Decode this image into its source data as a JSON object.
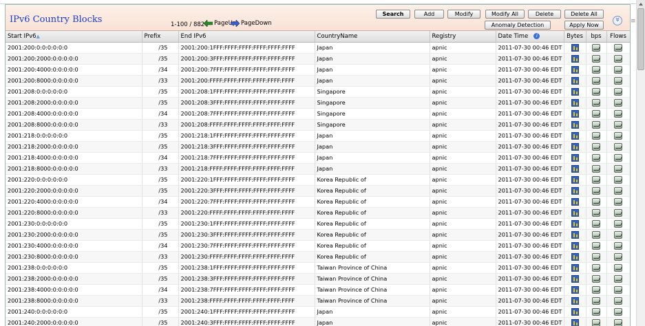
{
  "title": "IPv6 Country Blocks",
  "pagination": {
    "range": "1-100 / 8824",
    "page_up": "PageUp",
    "page_down": "PageDown"
  },
  "toolbar": {
    "search": "Search",
    "add": "Add",
    "modify": "Modify",
    "modify_all": "Modify All",
    "delete": "Delete",
    "delete_all": "Delete All",
    "anomaly": "Anomaly Detection",
    "apply_now": "Apply Now"
  },
  "columns": {
    "start": "Start IPv6",
    "prefix": "Prefix",
    "end": "End IPv6",
    "country": "CountryName",
    "registry": "Registry",
    "datetime": "Date Time",
    "bytes": "Bytes",
    "bps": "bps",
    "flows": "Flows"
  },
  "rows": [
    [
      "2001:200:0:0:0:0:0:0",
      "/35",
      "2001:200:1FFF:FFFF:FFFF:FFFF:FFFF:FFFF",
      "Japan",
      "apnic",
      "2011-07-30 00:46 EDT"
    ],
    [
      "2001:200:2000:0:0:0:0:0",
      "/35",
      "2001:200:3FFF:FFFF:FFFF:FFFF:FFFF:FFFF",
      "Japan",
      "apnic",
      "2011-07-30 00:46 EDT"
    ],
    [
      "2001:200:4000:0:0:0:0:0",
      "/34",
      "2001:200:7FFF:FFFF:FFFF:FFFF:FFFF:FFFF",
      "Japan",
      "apnic",
      "2011-07-30 00:46 EDT"
    ],
    [
      "2001:200:8000:0:0:0:0:0",
      "/33",
      "2001:200:FFFF:FFFF:FFFF:FFFF:FFFF:FFFF",
      "Japan",
      "apnic",
      "2011-07-30 00:46 EDT"
    ],
    [
      "2001:208:0:0:0:0:0:0",
      "/35",
      "2001:208:1FFF:FFFF:FFFF:FFFF:FFFF:FFFF",
      "Singapore",
      "apnic",
      "2011-07-30 00:46 EDT"
    ],
    [
      "2001:208:2000:0:0:0:0:0",
      "/35",
      "2001:208:3FFF:FFFF:FFFF:FFFF:FFFF:FFFF",
      "Singapore",
      "apnic",
      "2011-07-30 00:46 EDT"
    ],
    [
      "2001:208:4000:0:0:0:0:0",
      "/34",
      "2001:208:7FFF:FFFF:FFFF:FFFF:FFFF:FFFF",
      "Singapore",
      "apnic",
      "2011-07-30 00:46 EDT"
    ],
    [
      "2001:208:8000:0:0:0:0:0",
      "/33",
      "2001:208:FFFF:FFFF:FFFF:FFFF:FFFF:FFFF",
      "Singapore",
      "apnic",
      "2011-07-30 00:46 EDT"
    ],
    [
      "2001:218:0:0:0:0:0:0",
      "/35",
      "2001:218:1FFF:FFFF:FFFF:FFFF:FFFF:FFFF",
      "Japan",
      "apnic",
      "2011-07-30 00:46 EDT"
    ],
    [
      "2001:218:2000:0:0:0:0:0",
      "/35",
      "2001:218:3FFF:FFFF:FFFF:FFFF:FFFF:FFFF",
      "Japan",
      "apnic",
      "2011-07-30 00:46 EDT"
    ],
    [
      "2001:218:4000:0:0:0:0:0",
      "/34",
      "2001:218:7FFF:FFFF:FFFF:FFFF:FFFF:FFFF",
      "Japan",
      "apnic",
      "2011-07-30 00:46 EDT"
    ],
    [
      "2001:218:8000:0:0:0:0:0",
      "/33",
      "2001:218:FFFF:FFFF:FFFF:FFFF:FFFF:FFFF",
      "Japan",
      "apnic",
      "2011-07-30 00:46 EDT"
    ],
    [
      "2001:220:0:0:0:0:0:0",
      "/35",
      "2001:220:1FFF:FFFF:FFFF:FFFF:FFFF:FFFF",
      "Korea Republic of",
      "apnic",
      "2011-07-30 00:46 EDT"
    ],
    [
      "2001:220:2000:0:0:0:0:0",
      "/35",
      "2001:220:3FFF:FFFF:FFFF:FFFF:FFFF:FFFF",
      "Korea Republic of",
      "apnic",
      "2011-07-30 00:46 EDT"
    ],
    [
      "2001:220:4000:0:0:0:0:0",
      "/34",
      "2001:220:7FFF:FFFF:FFFF:FFFF:FFFF:FFFF",
      "Korea Republic of",
      "apnic",
      "2011-07-30 00:46 EDT"
    ],
    [
      "2001:220:8000:0:0:0:0:0",
      "/33",
      "2001:220:FFFF:FFFF:FFFF:FFFF:FFFF:FFFF",
      "Korea Republic of",
      "apnic",
      "2011-07-30 00:46 EDT"
    ],
    [
      "2001:230:0:0:0:0:0:0",
      "/35",
      "2001:230:1FFF:FFFF:FFFF:FFFF:FFFF:FFFF",
      "Korea Republic of",
      "apnic",
      "2011-07-30 00:46 EDT"
    ],
    [
      "2001:230:2000:0:0:0:0:0",
      "/35",
      "2001:230:3FFF:FFFF:FFFF:FFFF:FFFF:FFFF",
      "Korea Republic of",
      "apnic",
      "2011-07-30 00:46 EDT"
    ],
    [
      "2001:230:4000:0:0:0:0:0",
      "/34",
      "2001:230:7FFF:FFFF:FFFF:FFFF:FFFF:FFFF",
      "Korea Republic of",
      "apnic",
      "2011-07-30 00:46 EDT"
    ],
    [
      "2001:230:8000:0:0:0:0:0",
      "/33",
      "2001:230:FFFF:FFFF:FFFF:FFFF:FFFF:FFFF",
      "Korea Republic of",
      "apnic",
      "2011-07-30 00:46 EDT"
    ],
    [
      "2001:238:0:0:0:0:0:0",
      "/35",
      "2001:238:1FFF:FFFF:FFFF:FFFF:FFFF:FFFF",
      "Taiwan Province of China",
      "apnic",
      "2011-07-30 00:46 EDT"
    ],
    [
      "2001:238:2000:0:0:0:0:0",
      "/35",
      "2001:238:3FFF:FFFF:FFFF:FFFF:FFFF:FFFF",
      "Taiwan Province of China",
      "apnic",
      "2011-07-30 00:46 EDT"
    ],
    [
      "2001:238:4000:0:0:0:0:0",
      "/34",
      "2001:238:7FFF:FFFF:FFFF:FFFF:FFFF:FFFF",
      "Taiwan Province of China",
      "apnic",
      "2011-07-30 00:46 EDT"
    ],
    [
      "2001:238:8000:0:0:0:0:0",
      "/33",
      "2001:238:FFFF:FFFF:FFFF:FFFF:FFFF:FFFF",
      "Taiwan Province of China",
      "apnic",
      "2011-07-30 00:46 EDT"
    ],
    [
      "2001:240:0:0:0:0:0:0",
      "/35",
      "2001:240:1FFF:FFFF:FFFF:FFFF:FFFF:FFFF",
      "Japan",
      "apnic",
      "2011-07-30 00:46 EDT"
    ],
    [
      "2001:240:2000:0:0:0:0:0",
      "/35",
      "2001:240:3FFF:FFFF:FFFF:FFFF:FFFF:FFFF",
      "Japan",
      "apnic",
      "2011-07-30 00:46 EDT"
    ]
  ]
}
